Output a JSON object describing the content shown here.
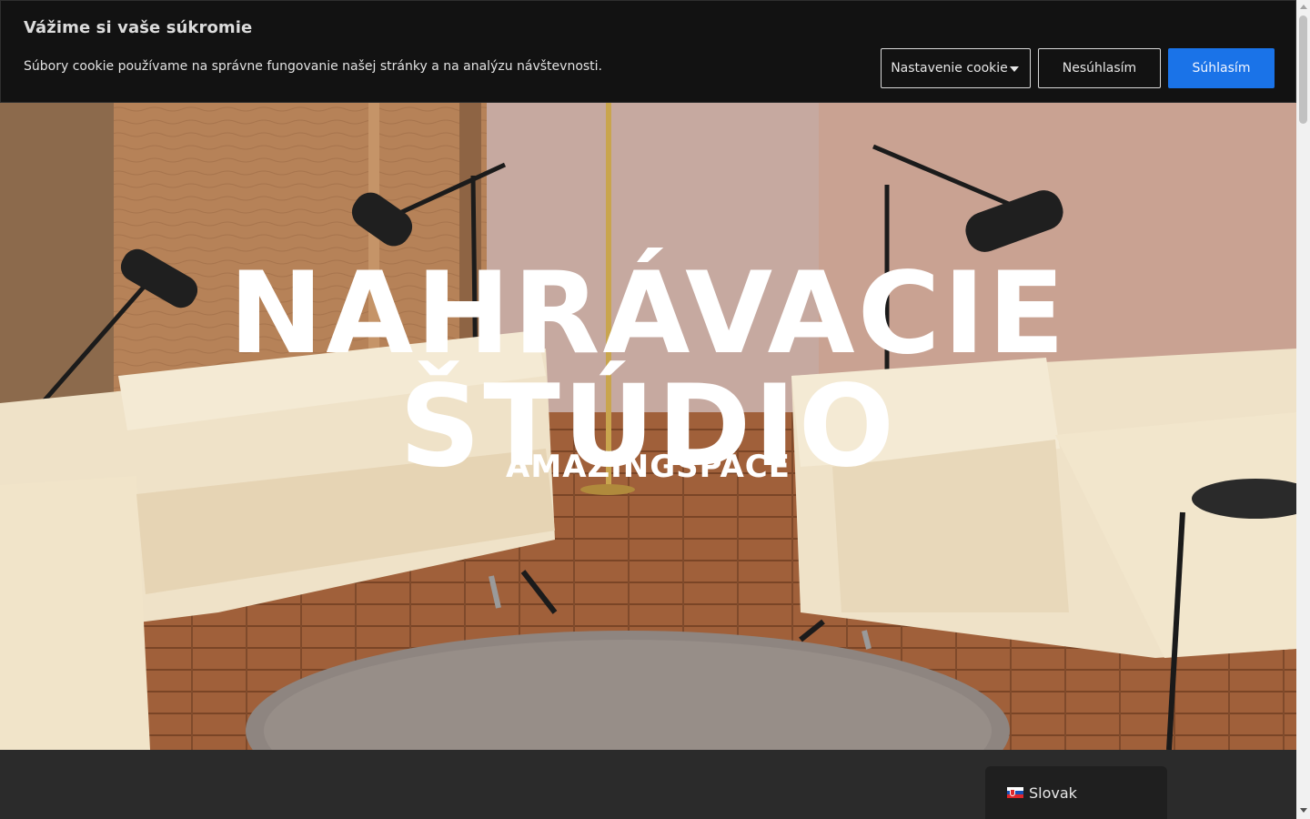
{
  "cookie_banner": {
    "title": "Vážime si vaše súkromie",
    "text": "Súbory cookie používame na správne fungovanie našej stránky a na analýzu návštevnosti.",
    "settings_label": "Nastavenie cookie",
    "decline_label": "Nesúhlasím",
    "accept_label": "Súhlasím"
  },
  "hero": {
    "title": "NAHRÁVACIE ŠTÚDIO",
    "subtitle": "AMAZINGSPACE"
  },
  "language_switcher": {
    "flag_icon": "slovak-flag-icon",
    "label": "Slovak"
  },
  "colors": {
    "banner_bg": "#121212",
    "accept_button": "#1a73e8",
    "lower_section": "#2b2b2b"
  }
}
